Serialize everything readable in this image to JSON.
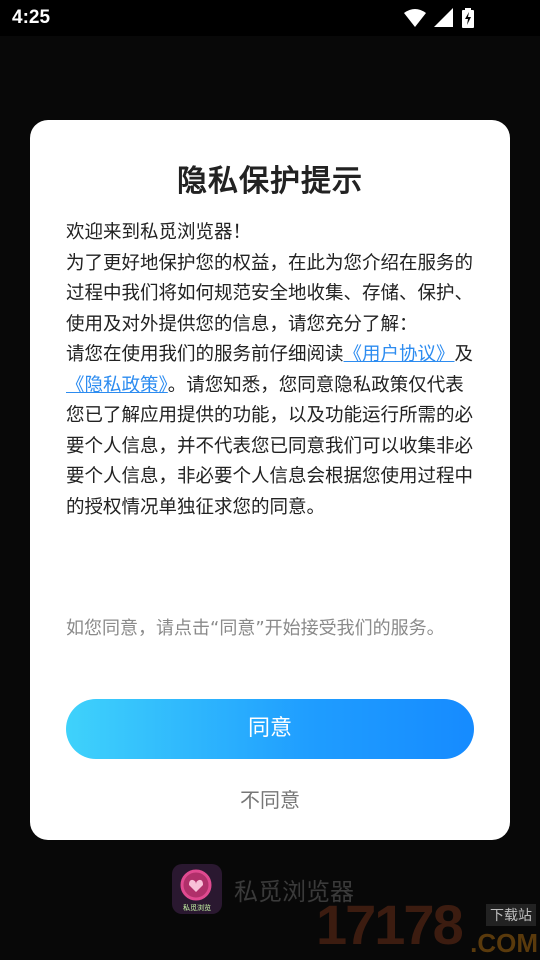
{
  "status_bar": {
    "time": "4:25",
    "icons": [
      "wifi-icon",
      "signal-icon",
      "battery-charging-icon"
    ]
  },
  "dialog": {
    "title": "隐私保护提示",
    "body": {
      "greeting": "欢迎来到私觅浏览器！",
      "intro": "为了更好地保护您的权益，在此为您介绍在服务的过程中我们将如何规范安全地收集、存储、保护、使用及对外提供您的信息，请您充分了解：",
      "read_prefix": "请您在使用我们的服务前仔细阅读",
      "user_agreement_link": "《用户协议》",
      "and_text": "及",
      "privacy_policy_link": "《隐私政策》",
      "read_suffix": "。请您知悉，您同意隐私政策仅代表您已了解应用提供的功能，以及功能运行所需的必要个人信息，并不代表您已同意我们可以收集非必要个人信息，非必要个人信息会根据您使用过程中的授权情况单独征求您的同意。"
    },
    "hint": "如您同意，请点击“同意”开始接受我们的服务。",
    "agree_label": "同意",
    "disagree_label": "不同意"
  },
  "background": {
    "app_name": "私觅浏览器",
    "logo_text": "私觅浏览",
    "watermark": {
      "number": "17178",
      "suffix": ".COM",
      "badge": "下载站"
    }
  },
  "colors": {
    "link": "#2d8cf0",
    "button_gradient_start": "#3fd2fb",
    "button_gradient_end": "#168bff"
  }
}
